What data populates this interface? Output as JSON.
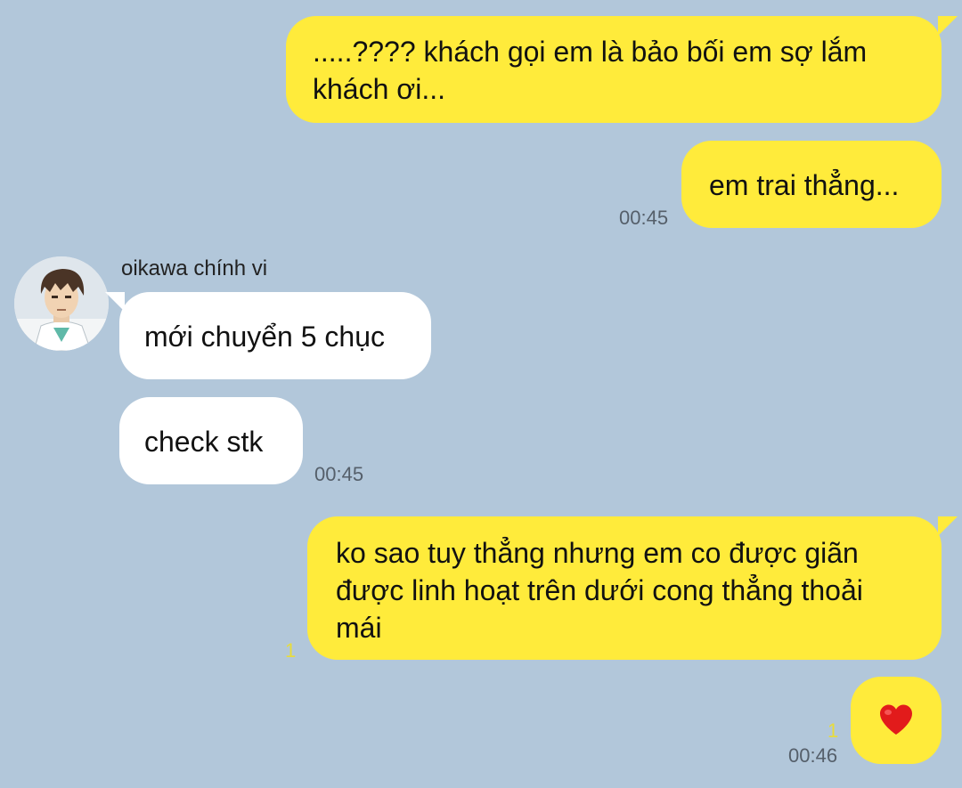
{
  "messages": [
    {
      "id": "m1",
      "from": "me",
      "text": ".....???? khách gọi em là bảo bối em sợ lắm khách ơi..."
    },
    {
      "id": "m2",
      "from": "me",
      "text": "em trai thẳng...",
      "time": "00:45"
    },
    {
      "id": "m3",
      "from": "them",
      "sender": "oikawa chính vi",
      "text": "mới chuyển 5 chục"
    },
    {
      "id": "m4",
      "from": "them",
      "text": "check stk",
      "time": "00:45"
    },
    {
      "id": "m5",
      "from": "me",
      "text": "ko sao tuy thẳng nhưng em co được giãn được linh hoạt trên dưới cong thẳng thoải mái",
      "read_count": "1"
    },
    {
      "id": "m6",
      "from": "me",
      "text": "❤️",
      "read_count": "1",
      "time": "00:46"
    }
  ],
  "contact": {
    "name": "oikawa chính vi",
    "avatar_icon": "oikawa-avatar"
  },
  "colors": {
    "background": "#b2c7da",
    "my_bubble": "#ffeb3b",
    "their_bubble": "#ffffff"
  }
}
